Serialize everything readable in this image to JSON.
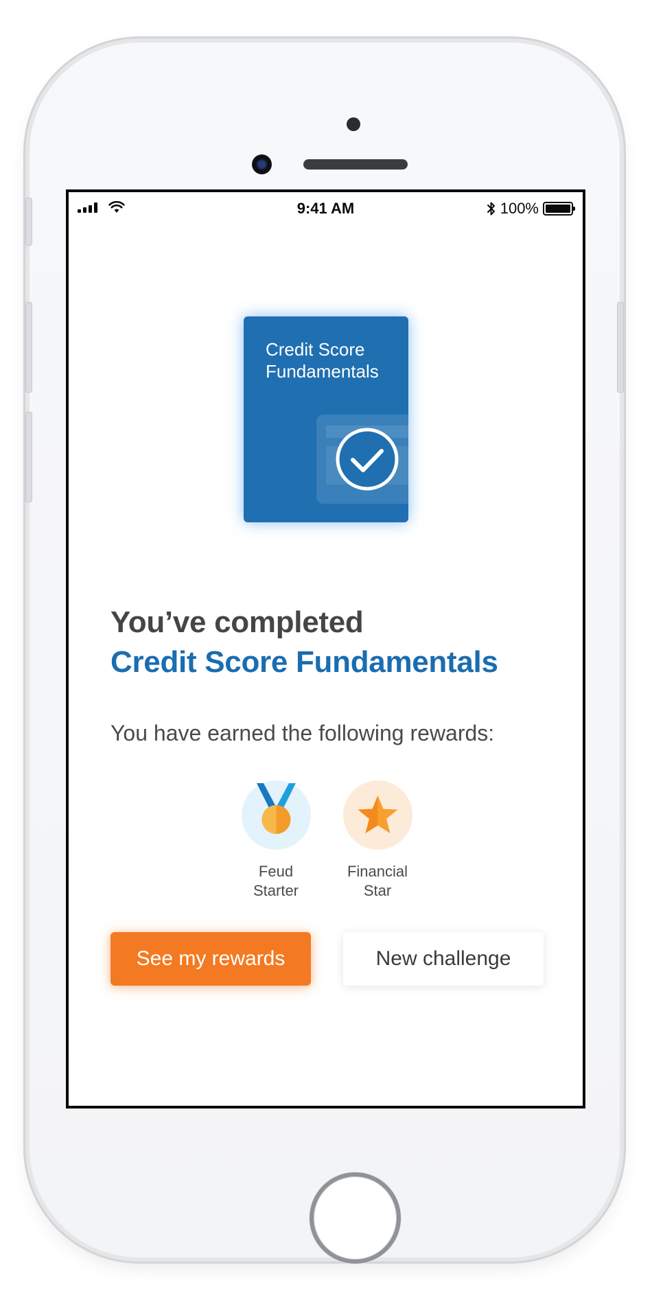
{
  "status_bar": {
    "time": "9:41 AM",
    "battery_percent": "100%",
    "signal_bars": 4,
    "battery_level": 1.0
  },
  "course_card": {
    "title": "Credit Score Fundamentals",
    "color": "#1f6fb1",
    "icon": "check-circle-icon"
  },
  "completion": {
    "heading": "You’ve completed",
    "course_name": "Credit Score Fundamentals",
    "rewards_intro": "You have earned the following rewards:"
  },
  "rewards": [
    {
      "label_line1": "Feud",
      "label_line2": "Starter",
      "icon": "medal-icon",
      "badge_bg": "#e3f3fb"
    },
    {
      "label_line1": "Financial",
      "label_line2": "Star",
      "icon": "star-icon",
      "badge_bg": "#fdebd9"
    }
  ],
  "actions": {
    "primary_label": "See my rewards",
    "secondary_label": "New challenge"
  },
  "colors": {
    "accent_orange": "#f37a22",
    "brand_blue": "#1a6db0",
    "heading_gray": "#454545"
  }
}
